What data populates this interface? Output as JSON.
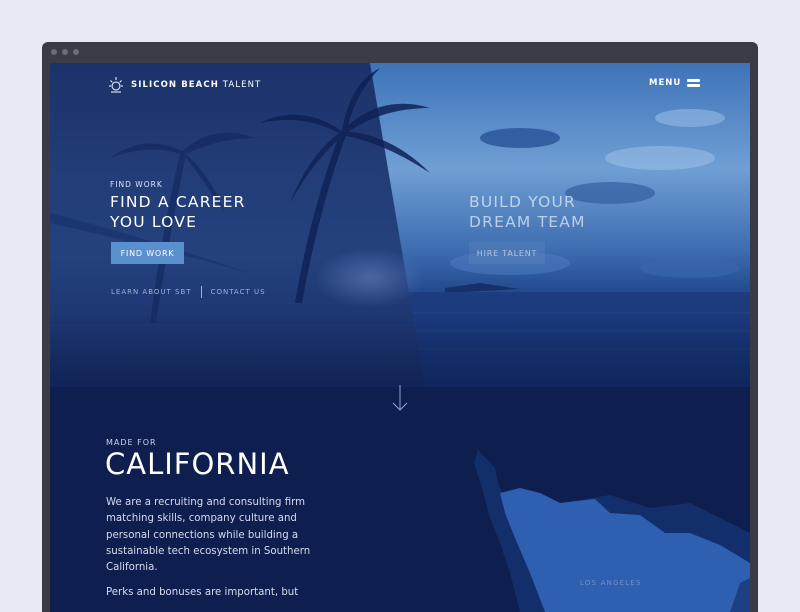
{
  "brand": {
    "name_bold": "SILICON BEACH",
    "name_light": "TALENT"
  },
  "nav": {
    "menu_label": "MENU"
  },
  "hero_left": {
    "eyebrow": "FIND WORK",
    "headline": "FIND A CAREER\nYOU LOVE",
    "button": "FIND WORK",
    "link_learn": "LEARN ABOUT SBT",
    "link_contact": "CONTACT US"
  },
  "hero_right": {
    "headline": "BUILD YOUR\nDREAM TEAM",
    "button": "HIRE TALENT"
  },
  "about": {
    "eyebrow": "MADE FOR",
    "title": "CALIFORNIA",
    "paragraph": "We are a recruiting and consulting firm matching skills, company culture and personal connections while building a sustainable tech ecosystem in Southern California.",
    "paragraph_2": "Perks and bonuses are important, but",
    "map_label": "LOS ANGELES"
  },
  "colors": {
    "page_bg": "#e9e9f3",
    "browser_frame": "#3a3b43",
    "navy": "#0e1f4f",
    "accent_button": "#5b90cf",
    "map_land": "#2f5fb0"
  }
}
